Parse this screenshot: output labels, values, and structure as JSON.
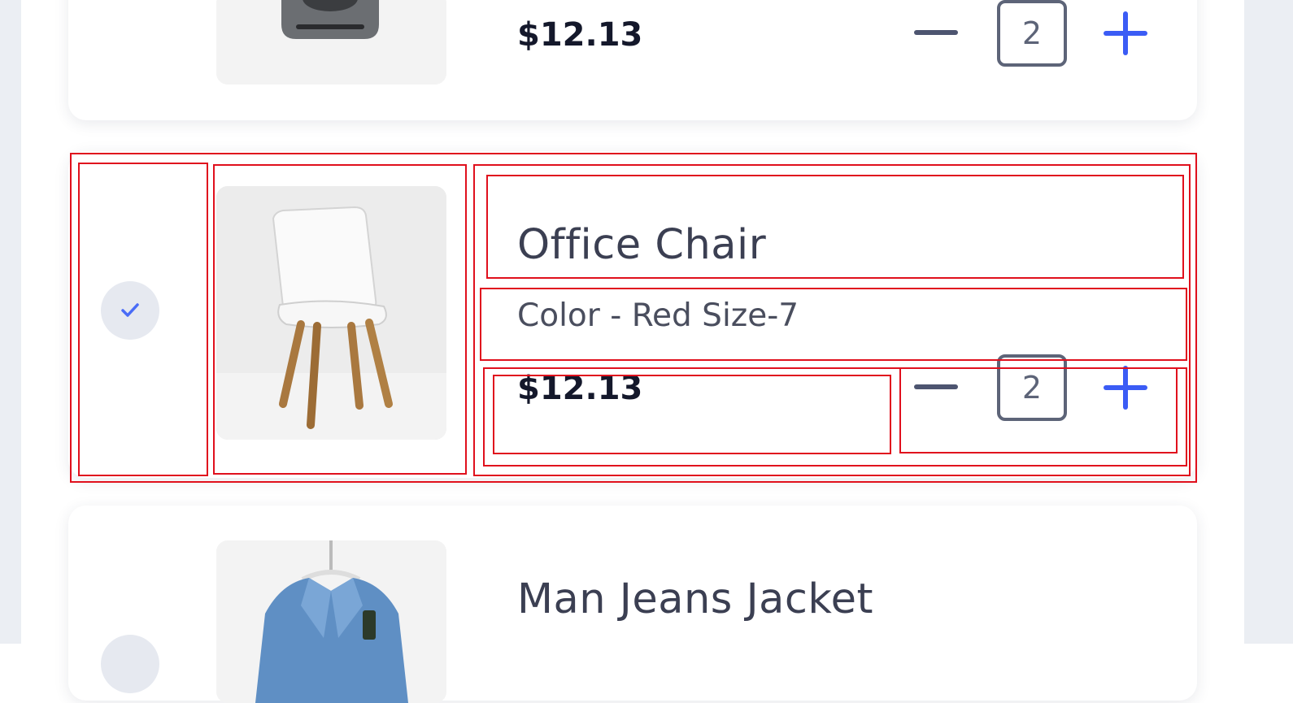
{
  "cart": {
    "items": [
      {
        "price": "$12.13",
        "quantity": "2"
      },
      {
        "title": "Office Chair",
        "options": "Color - Red  Size-7",
        "price": "$12.13",
        "quantity": "2",
        "selected": true
      },
      {
        "title": "Man Jeans Jacket"
      }
    ]
  },
  "colors": {
    "accent": "#3b5cf5",
    "text_dark": "#14182b",
    "title": "#3b3f52",
    "annotation": "#e0101d"
  },
  "icons": {
    "check": "check-icon",
    "minus": "minus-icon",
    "plus": "plus-icon"
  }
}
